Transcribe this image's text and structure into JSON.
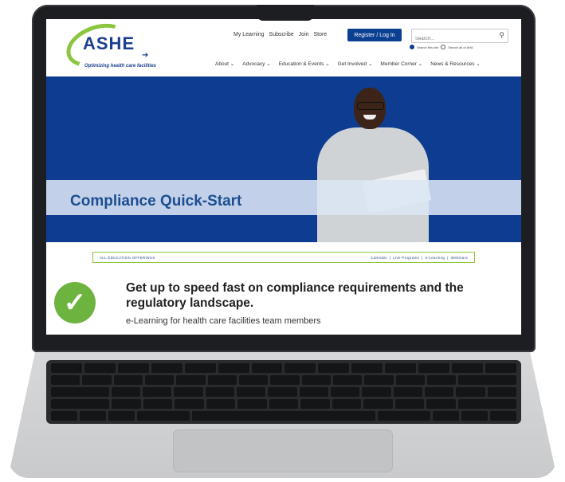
{
  "header": {
    "logo_text": "ASHE",
    "logo_tagline": "Optimizing health care facilities",
    "top_links": [
      "My Learning",
      "Subscribe",
      "Join",
      "Store"
    ],
    "register_label": "Register / Log In",
    "search_placeholder": "Search...",
    "search_option_site": "Search this site",
    "search_option_aha": "Search all of AHA"
  },
  "nav": {
    "items": [
      "About ⌄",
      "Advocacy ⌄",
      "Education & Events ⌄",
      "Get Involved ⌄",
      "Member Corner ⌄",
      "News & Resources ⌄"
    ]
  },
  "hero": {
    "title": "Compliance Quick-Start"
  },
  "offerings": {
    "left": "ALL EDUCATION OFFERINGS",
    "right": [
      "Calendar",
      "|",
      "Live Programs",
      "|",
      "e-Learning",
      "|",
      "Webinars"
    ]
  },
  "content": {
    "headline": "Get up to speed fast on compliance requirements and the regulatory landscape.",
    "subline": "e-Learning for health care facilities team members"
  },
  "colors": {
    "brand_blue": "#0e3c91",
    "brand_green": "#8cc63f",
    "check_green": "#6cb33f"
  }
}
